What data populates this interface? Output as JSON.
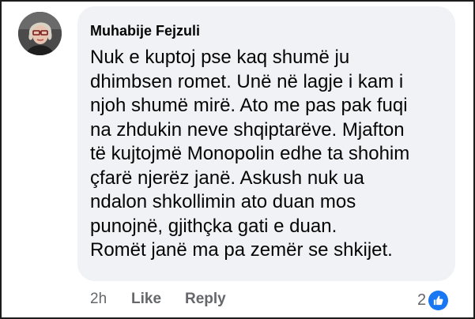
{
  "comment": {
    "author": "Muhabije Fejzuli",
    "lines": [
      "Nuk e kuptoj pse kaq shumë ju",
      "dhimbsen romet. Unë në lagje i kam i",
      "njoh shumë mirë. Ato me pas pak fuqi",
      "na zhdukin neve shqiptarëve. Mjafton",
      "të kujtojmë Monopolin edhe ta shohim",
      "çfarë njerëz janë. Askush nuk ua",
      "ndalon shkollimin ato duan mos",
      "punojnë, gjithçka gati e duan.",
      "Romët janë ma pa zemër se shkijet."
    ]
  },
  "actions": {
    "time": "2h",
    "like_label": "Like",
    "reply_label": "Reply"
  },
  "reactions": {
    "count": "2",
    "icon": "like-icon"
  },
  "colors": {
    "bubble": "#f0f2f5",
    "text": "#050505",
    "secondary": "#65676b",
    "like_blue": "#1877f2"
  }
}
